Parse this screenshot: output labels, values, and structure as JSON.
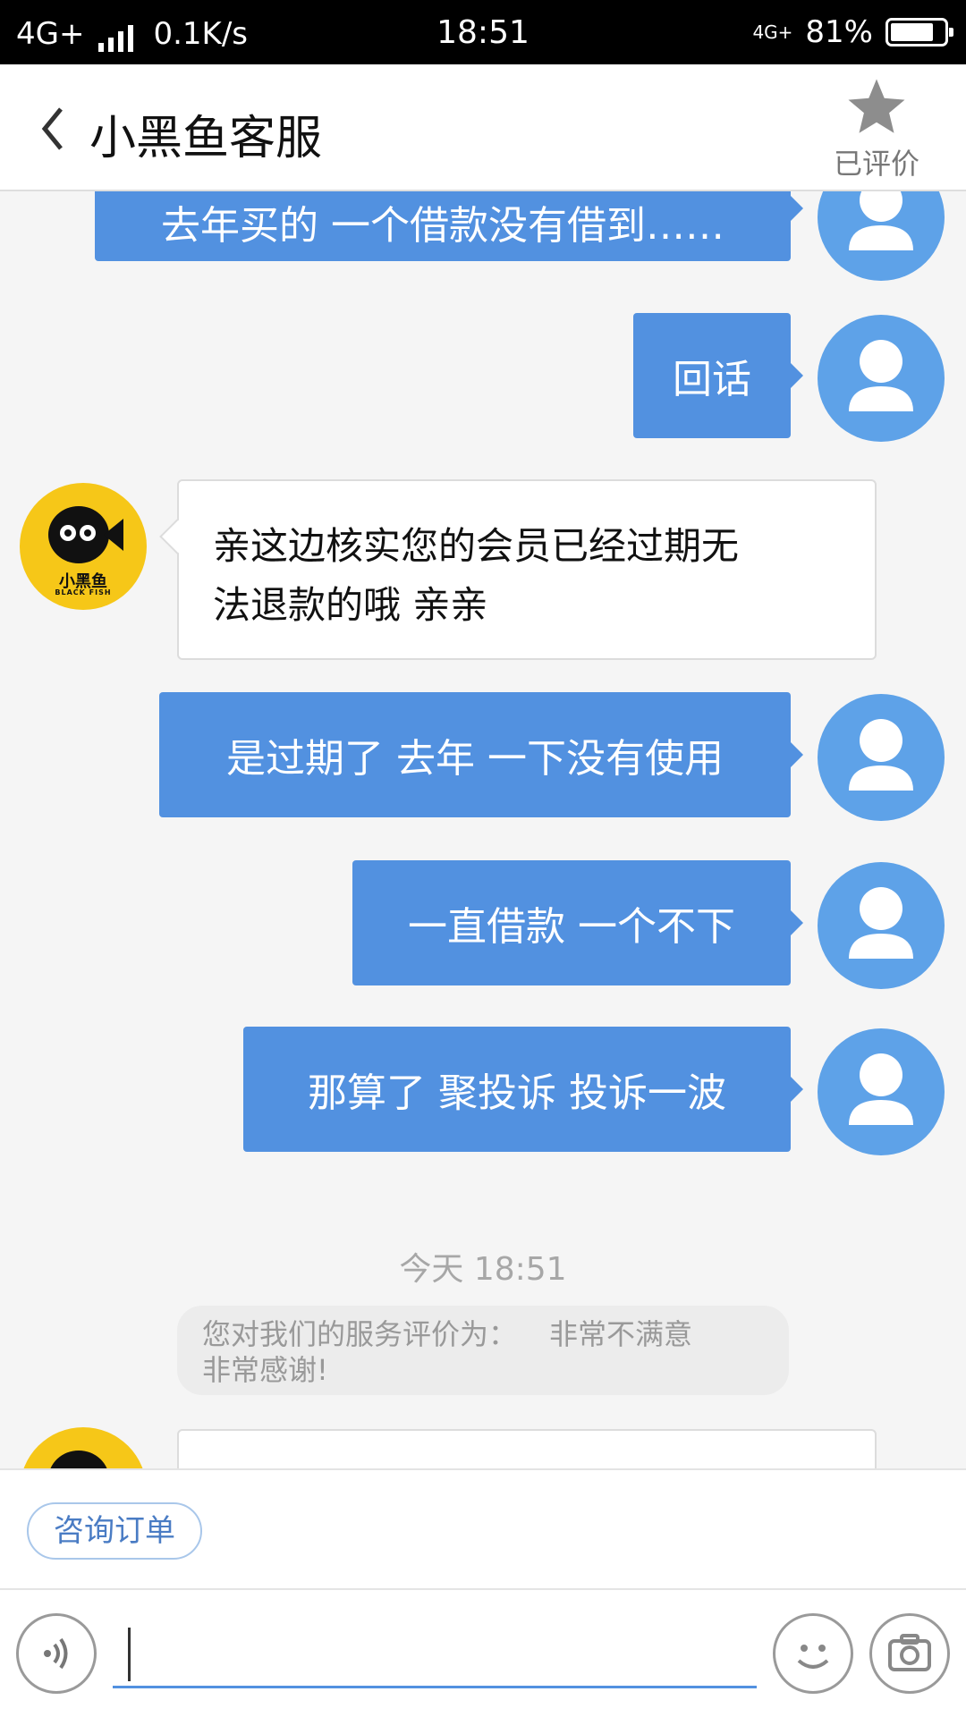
{
  "status_bar": {
    "network": "4G+",
    "speed": "0.1K/s",
    "time": "18:51",
    "network_right": "4G+",
    "battery": "81%",
    "battery_level": 0.81
  },
  "header": {
    "title": "小黑鱼客服",
    "rated_label": "已评价"
  },
  "messages": [
    {
      "side": "user",
      "text": "去年买的  一个借款没有借到……"
    },
    {
      "side": "user",
      "text": "回话"
    },
    {
      "side": "agent",
      "line1": "亲这边核实您的会员已经过期无",
      "line2": "法退款的哦  亲亲"
    },
    {
      "side": "user",
      "text": "是过期了   去年 一下没有使用"
    },
    {
      "side": "user",
      "text": "一直借款  一个不下"
    },
    {
      "side": "user",
      "text": "那算了  聚投诉  投诉一波"
    }
  ],
  "bot_avatar": {
    "name": "小黑鱼",
    "subtitle": "BLACK FISH"
  },
  "timestamp": "今天 18:51",
  "system_note": {
    "prefix": "您对我们的服务评价为：",
    "rating": "非常不满意",
    "thanks": "非常感谢!"
  },
  "quick_actions": [
    "咨询订单"
  ],
  "input": {
    "value": "",
    "placeholder": ""
  },
  "icons": {
    "back": "chevron-left-icon",
    "rated": "star-icon",
    "voice": "voice-icon",
    "emoji": "emoji-icon",
    "camera": "camera-icon",
    "user_avatar": "user-avatar-icon"
  },
  "colors": {
    "user_bubble": "#5291e0",
    "user_avatar": "#5ea2e8",
    "bot_avatar": "#f6c718",
    "background": "#f5f5f5"
  }
}
